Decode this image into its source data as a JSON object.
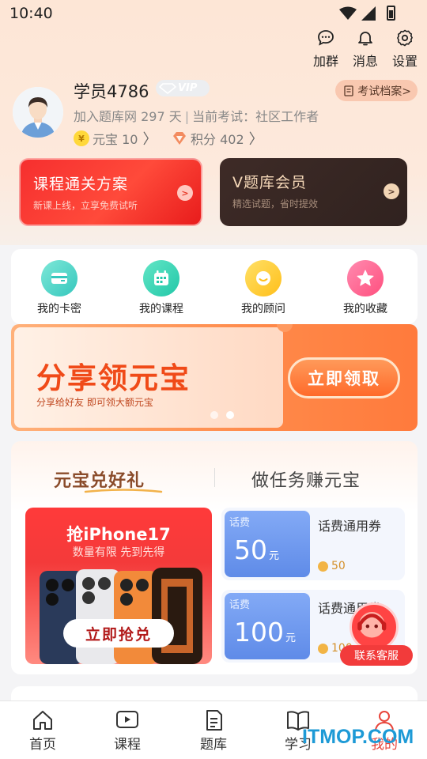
{
  "status_bar": {
    "time": "10:40"
  },
  "top_actions": [
    {
      "label": "加群",
      "icon": "chat-bubble-icon"
    },
    {
      "label": "消息",
      "icon": "bell-icon"
    },
    {
      "label": "设置",
      "icon": "gear-icon"
    }
  ],
  "profile": {
    "username": "学员4786",
    "vip_label": "VIP",
    "joined": "加入题库网 297 天",
    "current_exam": "当前考试：社区工作者",
    "archive_button": "考试档案>",
    "yuanbao_label": "元宝 10",
    "points_label": "积分 402"
  },
  "promos": [
    {
      "title": "课程通关方案",
      "subtitle": "新课上线，立享免费试听",
      "arrow": ">"
    },
    {
      "title": "V题库会员",
      "subtitle": "精选试题，省时提效",
      "arrow": ">"
    }
  ],
  "quick_menu": [
    {
      "label": "我的卡密",
      "icon": "card-icon",
      "color": "#3fcfc0"
    },
    {
      "label": "我的课程",
      "icon": "calendar-icon",
      "color": "#30d2b0"
    },
    {
      "label": "我的顾问",
      "icon": "advisor-icon",
      "color": "#ffca2c"
    },
    {
      "label": "我的收藏",
      "icon": "star-icon",
      "color": "#ff5e8a"
    }
  ],
  "share_banner": {
    "title": "分享领元宝",
    "subtitle": "分享给好友 即可领大额元宝",
    "button": "立即领取"
  },
  "gift_section": {
    "tab_left": "元宝兑好礼",
    "tab_right": "做任务赚元宝",
    "iphone": {
      "title": "抢iPhone17",
      "subtitle": "数量有限 先到先得",
      "button": "立即抢兑"
    },
    "coupons": [
      {
        "tag": "话费",
        "amount": "50",
        "unit": "元",
        "name": "话费通用券",
        "cost": "50"
      },
      {
        "tag": "话费",
        "amount": "100",
        "unit": "元",
        "name": "话费通用券",
        "cost": "100"
      }
    ]
  },
  "service": {
    "label": "联系客服"
  },
  "bottom_nav": [
    {
      "label": "首页",
      "icon": "home-icon"
    },
    {
      "label": "课程",
      "icon": "play-icon"
    },
    {
      "label": "题库",
      "icon": "document-icon"
    },
    {
      "label": "学习",
      "icon": "book-icon"
    },
    {
      "label": "我的",
      "icon": "user-icon",
      "active": true
    }
  ],
  "watermark": "ITMOP.COM"
}
